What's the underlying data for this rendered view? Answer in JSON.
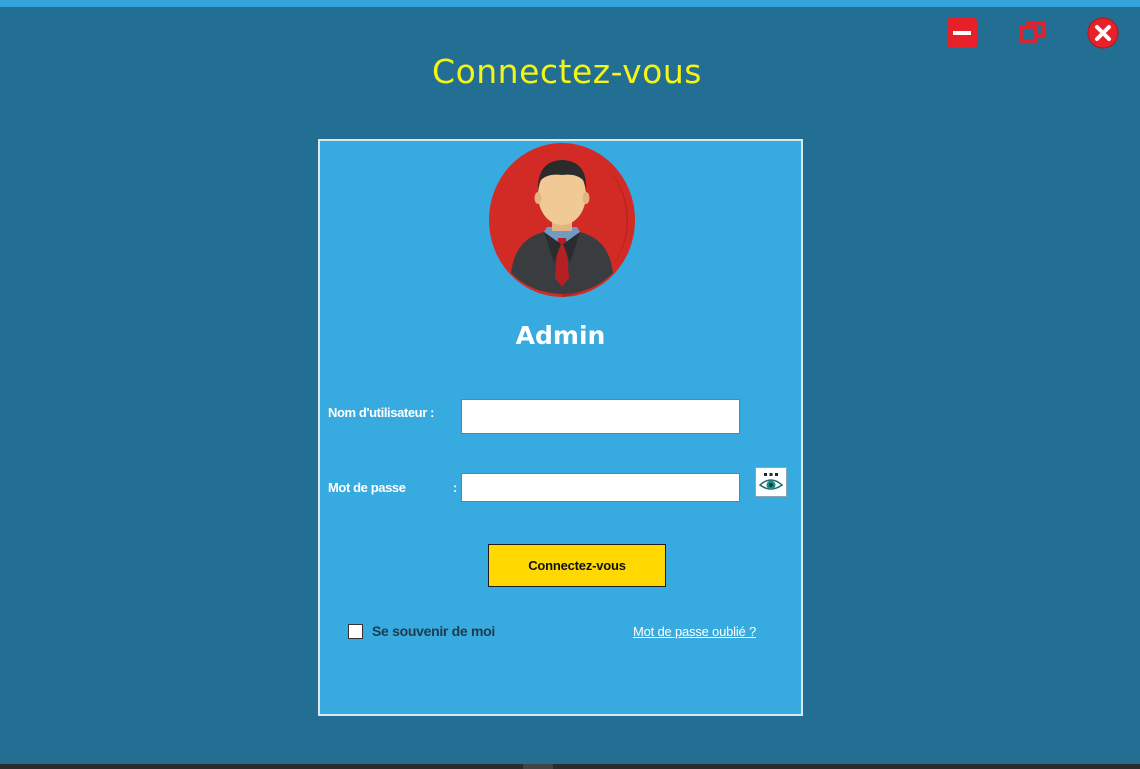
{
  "window": {
    "title": "Connectez-vous",
    "controls": {
      "minimize_icon": "minimize-icon",
      "restore_icon": "restore-icon",
      "close_icon": "close-icon"
    }
  },
  "colors": {
    "background": "#236f93",
    "panel": "#37aadf",
    "title": "#f4f416",
    "button": "#ffd800",
    "control_red": "#e8202a"
  },
  "login": {
    "avatar_icon": "user-avatar-icon",
    "user_name": "Admin",
    "username_label": "Nom d'utilisateur :",
    "username_value": "",
    "password_label": "Mot de passe",
    "password_colon": ":",
    "password_value": "",
    "show_password_icon": "eye-icon",
    "submit_label": "Connectez-vous",
    "remember_label": "Se souvenir de moi",
    "remember_checked": false,
    "forgot_link": "Mot de passe oublié ?"
  }
}
